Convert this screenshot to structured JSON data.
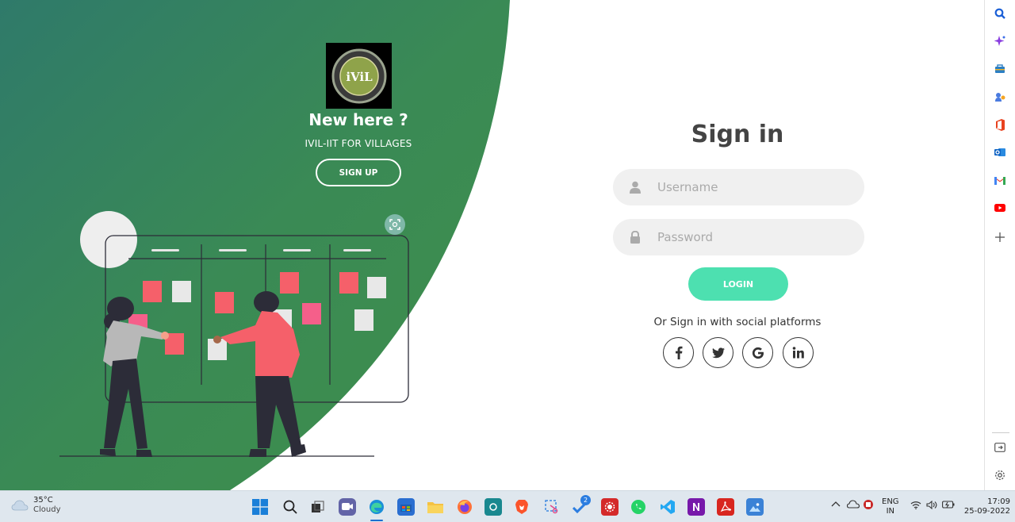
{
  "left_panel": {
    "heading": "New here ?",
    "subtitle": "IVIL-IIT FOR VILLAGES",
    "signup_label": "SIGN UP",
    "logo_text": "iViL",
    "colors": {
      "green": "#3e8c4f",
      "green_dark": "#2f7a61"
    }
  },
  "form": {
    "title": "Sign in",
    "username_placeholder": "Username",
    "password_placeholder": "Password",
    "login_label": "LOGIN",
    "social_text": "Or Sign in with social platforms",
    "social": [
      {
        "name": "facebook",
        "glyph": "f"
      },
      {
        "name": "twitter",
        "glyph": "t"
      },
      {
        "name": "google",
        "glyph": "G"
      },
      {
        "name": "linkedin",
        "glyph": "in"
      }
    ],
    "colors": {
      "login": "#4de0b0",
      "field_bg": "#f0f0f0"
    }
  },
  "edge_sidebar": {
    "icons": [
      "search-icon",
      "copilot-icon",
      "tools-icon",
      "games-icon",
      "office-icon",
      "outlook-icon",
      "gmail-icon",
      "youtube-icon",
      "add-icon",
      "layout-icon",
      "settings-icon"
    ]
  },
  "taskbar": {
    "weather_temp": "35°C",
    "weather_desc": "Cloudy",
    "lang_top": "ENG",
    "lang_bottom": "IN",
    "time": "17:09",
    "date": "25-09-2022",
    "badge": "2"
  }
}
